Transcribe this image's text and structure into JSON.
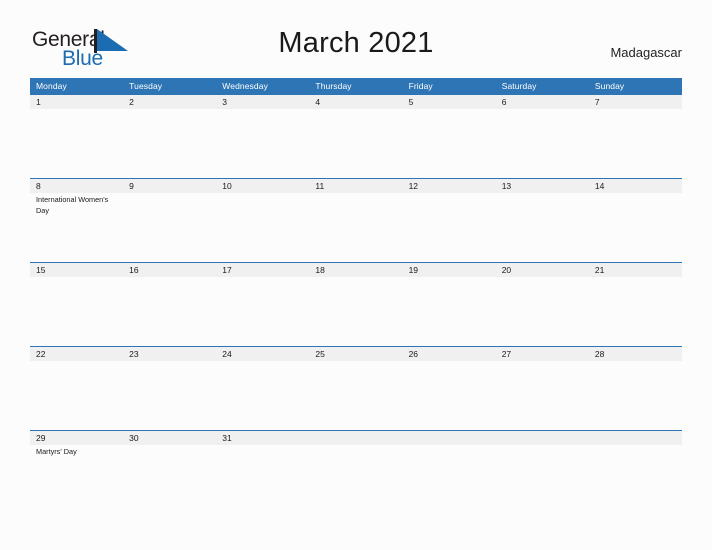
{
  "brand": {
    "name_part1": "General",
    "name_part2": "Blue",
    "triangle_color": "#1b6cb0",
    "text_color": "#231f20"
  },
  "header": {
    "title": "March 2021",
    "country": "Madagascar"
  },
  "theme": {
    "header_blue": "#2e75b6",
    "date_band_gray": "#f0f0f0",
    "page_background": "#fcfcfc",
    "rule_blue": "#2e75b6"
  },
  "calendar": {
    "month": "March",
    "year": "2021",
    "weekday_headers": [
      "Monday",
      "Tuesday",
      "Wednesday",
      "Thursday",
      "Friday",
      "Saturday",
      "Sunday"
    ],
    "weeks": [
      {
        "dates": [
          "1",
          "2",
          "3",
          "4",
          "5",
          "6",
          "7"
        ],
        "events": [
          "",
          "",
          "",
          "",
          "",
          "",
          ""
        ]
      },
      {
        "dates": [
          "8",
          "9",
          "10",
          "11",
          "12",
          "13",
          "14"
        ],
        "events": [
          "International Women's Day",
          "",
          "",
          "",
          "",
          "",
          ""
        ]
      },
      {
        "dates": [
          "15",
          "16",
          "17",
          "18",
          "19",
          "20",
          "21"
        ],
        "events": [
          "",
          "",
          "",
          "",
          "",
          "",
          ""
        ]
      },
      {
        "dates": [
          "22",
          "23",
          "24",
          "25",
          "26",
          "27",
          "28"
        ],
        "events": [
          "",
          "",
          "",
          "",
          "",
          "",
          ""
        ]
      },
      {
        "dates": [
          "29",
          "30",
          "31",
          "",
          "",
          "",
          ""
        ],
        "events": [
          "Martyrs' Day",
          "",
          "",
          "",
          "",
          "",
          ""
        ]
      }
    ]
  }
}
